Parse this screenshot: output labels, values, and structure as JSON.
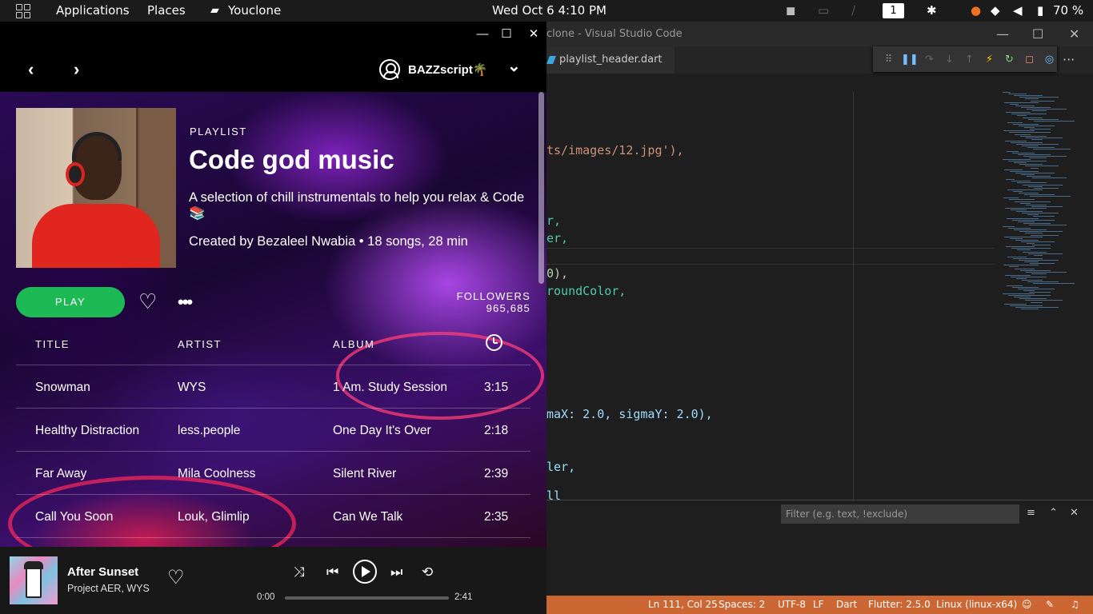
{
  "topbar": {
    "applications": "Applications",
    "places": "Places",
    "active_app": "Youclone",
    "datetime": "Wed Oct 6  4:10 PM",
    "workspace": "1",
    "battery": "70 %"
  },
  "vscode": {
    "title": "clone - Visual Studio Code",
    "tab": "playlist_header.dart",
    "code_lines": [
      "ts/images/12.jpg'),",
      "r,",
      "er,",
      "0),",
      "roundColor,",
      "maX: 2.0, sigmaY: 2.0),",
      "ler,",
      "ll"
    ],
    "filter_placeholder": "Filter (e.g. text, !exclude)",
    "status": {
      "position": "Ln 111, Col 25",
      "spaces": "Spaces: 2",
      "encoding": "UTF-8",
      "eol": "LF",
      "language": "Dart",
      "flutter": "Flutter: 2.5.0",
      "platform": "Linux (linux-x64)"
    }
  },
  "app": {
    "username": "BAZZscript🌴",
    "playlist": {
      "kind": "PLAYLIST",
      "title": "Code god music",
      "description": "A selection of chill instrumentals to help you relax & Code 📚",
      "meta": "Created by Bezaleel Nwabia • 18 songs, 28 min",
      "play_label": "PLAY",
      "followers_label": "FOLLOWERS",
      "followers_count": "965,685"
    },
    "columns": {
      "title": "TITLE",
      "artist": "ARTIST",
      "album": "ALBUM"
    },
    "tracks": [
      {
        "title": "Snowman",
        "artist": "WYS",
        "album": "1 Am. Study Session",
        "duration": "3:15"
      },
      {
        "title": "Healthy Distraction",
        "artist": "less.people",
        "album": "One Day It's Over",
        "duration": "2:18"
      },
      {
        "title": "Far Away",
        "artist": "Mila Coolness",
        "album": "Silent River",
        "duration": "2:39"
      },
      {
        "title": "Call You Soon",
        "artist": "Louk, Glimlip",
        "album": "Can We Talk",
        "duration": "2:35"
      }
    ],
    "now_playing": {
      "title": "After Sunset",
      "artist": "Project AER, WYS",
      "elapsed": "0:00",
      "total": "2:41",
      "progress": 0
    }
  }
}
